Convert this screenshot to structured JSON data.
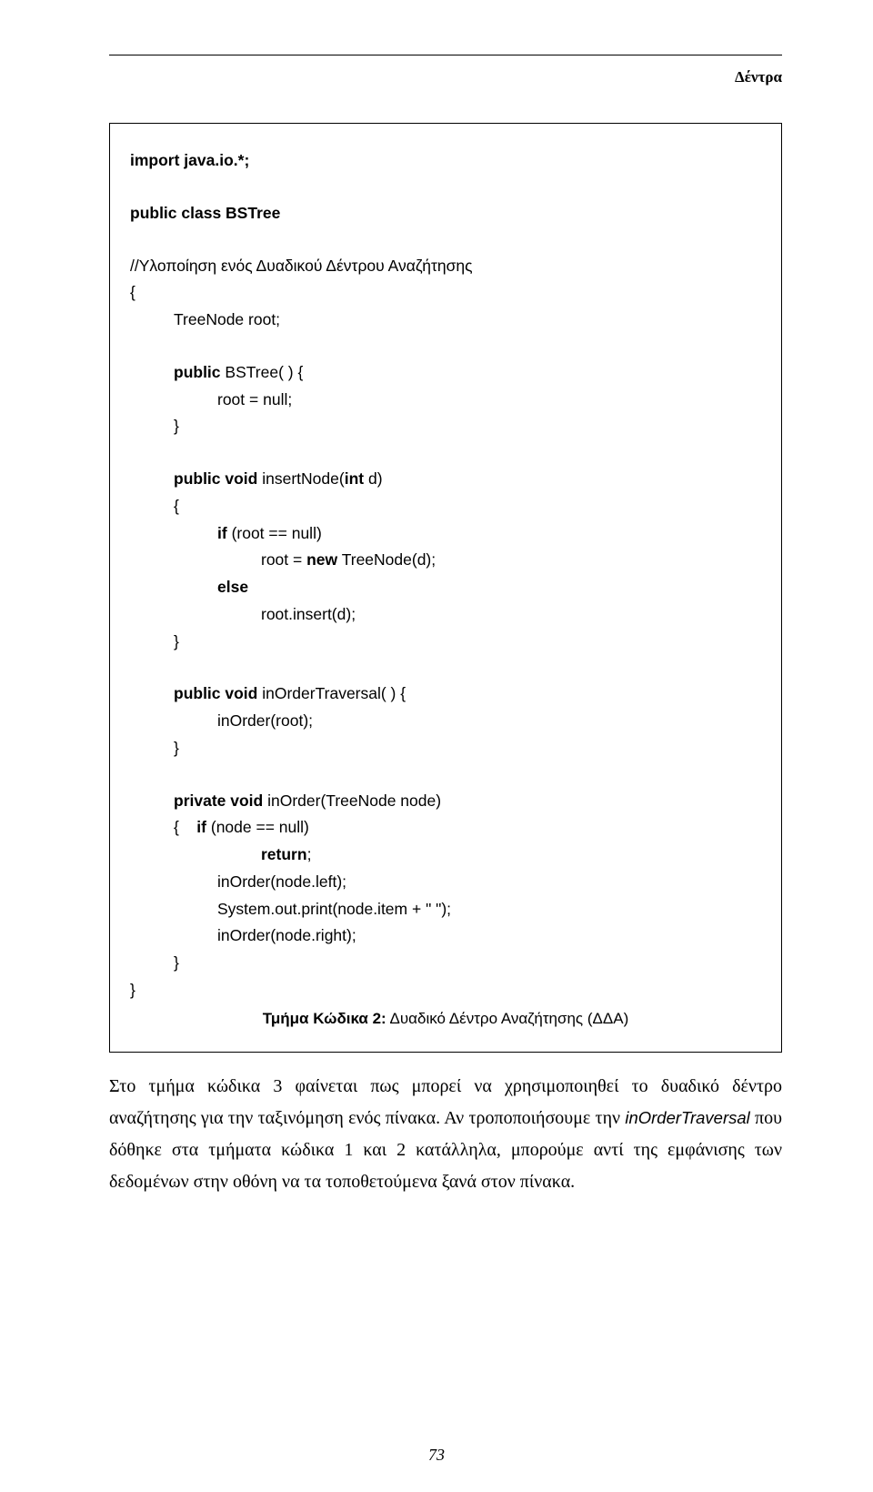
{
  "header": {
    "section_label": "Δέντρα"
  },
  "code": {
    "import": "import java.io.*;",
    "class_decl": "public class BSTree",
    "class_comment": "//Υλοποίηση ενός Δυαδικού Δέντρου Αναζήτησης",
    "open_brace": "{",
    "root_field": "TreeNode root;",
    "ctor_sig_prefix": "public",
    "ctor_sig_rest": " BSTree( ) {",
    "ctor_body": "root = null;",
    "close_brace": "}",
    "insert_sig_p1": "public void",
    "insert_sig_p2": " insertNode(",
    "insert_sig_p3": "int",
    "insert_sig_p4": " d)",
    "insert_open": "{",
    "insert_if_kw": "if",
    "insert_if_cond": " (root == null)",
    "insert_new_a": "root = ",
    "insert_new_kw": "new",
    "insert_new_b": " TreeNode(d);",
    "insert_else_kw": "else",
    "insert_else_stmt": "root.insert(d);",
    "trav_sig_p1": "public void",
    "trav_sig_p2": " inOrderTraversal( ) {",
    "trav_body": "inOrder(root);",
    "inorder_sig_p1": "private void",
    "inorder_sig_p2": " inOrder(TreeNode node)",
    "inorder_if_line_a": "{    ",
    "inorder_if_kw": "if",
    "inorder_if_cond": " (node == null)",
    "inorder_return_kw": "return",
    "inorder_return_sc": ";",
    "inorder_left": "inOrder(node.left);",
    "inorder_print": "System.out.print(node.item + \" \");",
    "inorder_right": "inOrder(node.right);"
  },
  "caption": {
    "label_bold": "Τμήμα Κώδικα 2:",
    "label_rest": " Δυαδικό Δέντρο Αναζήτησης (ΔΔΑ)"
  },
  "body": {
    "p1a": "Στο τμήμα κώδικα 3 φαίνεται πως μπορεί να χρησιμοποιηθεί το δυαδικό δέντρο αναζήτησης για την ταξινόμηση ενός πίνακα. Αν τροποποιήσουμε την ",
    "p1_ident": "inOrderTraversal",
    "p1b": " που δόθηκε στα τμήματα κώδικα 1 και 2 κατάλληλα, μπορούμε αντί της εμφάνισης των δεδομένων στην οθόνη να τα τοποθετούμενα ξανά στον πίνακα."
  },
  "page_number": "73"
}
